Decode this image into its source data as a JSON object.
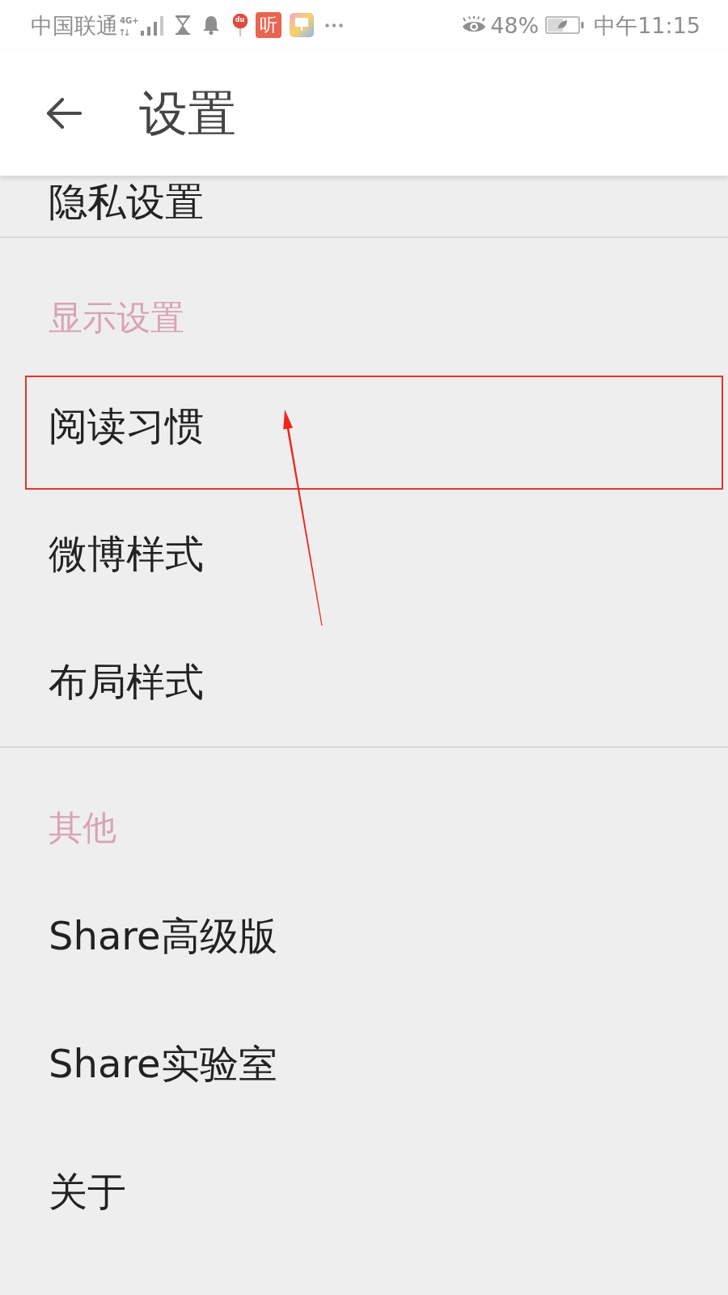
{
  "status_bar": {
    "carrier": "中国联通",
    "network": "4G+",
    "notifications": [
      {
        "kind": "hourglass"
      },
      {
        "kind": "bell"
      },
      {
        "kind": "pin",
        "label": "du"
      },
      {
        "kind": "text_tile",
        "label": "听"
      },
      {
        "kind": "gradient_tile"
      },
      {
        "kind": "more"
      }
    ],
    "indicators": [
      {
        "kind": "eye"
      }
    ],
    "battery": "48%",
    "time": "中午11:15"
  },
  "header": {
    "title": "设置"
  },
  "sections": [
    {
      "items": [
        {
          "label": "隐私设置",
          "highlighted": false
        }
      ]
    },
    {
      "title": "显示设置",
      "items": [
        {
          "label": "阅读习惯",
          "highlighted": true
        },
        {
          "label": "微博样式",
          "highlighted": false
        },
        {
          "label": "布局样式",
          "highlighted": false
        }
      ]
    },
    {
      "title": "其他",
      "items": [
        {
          "label": "Share高级版",
          "highlighted": false
        },
        {
          "label": "Share实验室",
          "highlighted": false
        },
        {
          "label": "关于",
          "highlighted": false
        }
      ]
    }
  ]
}
